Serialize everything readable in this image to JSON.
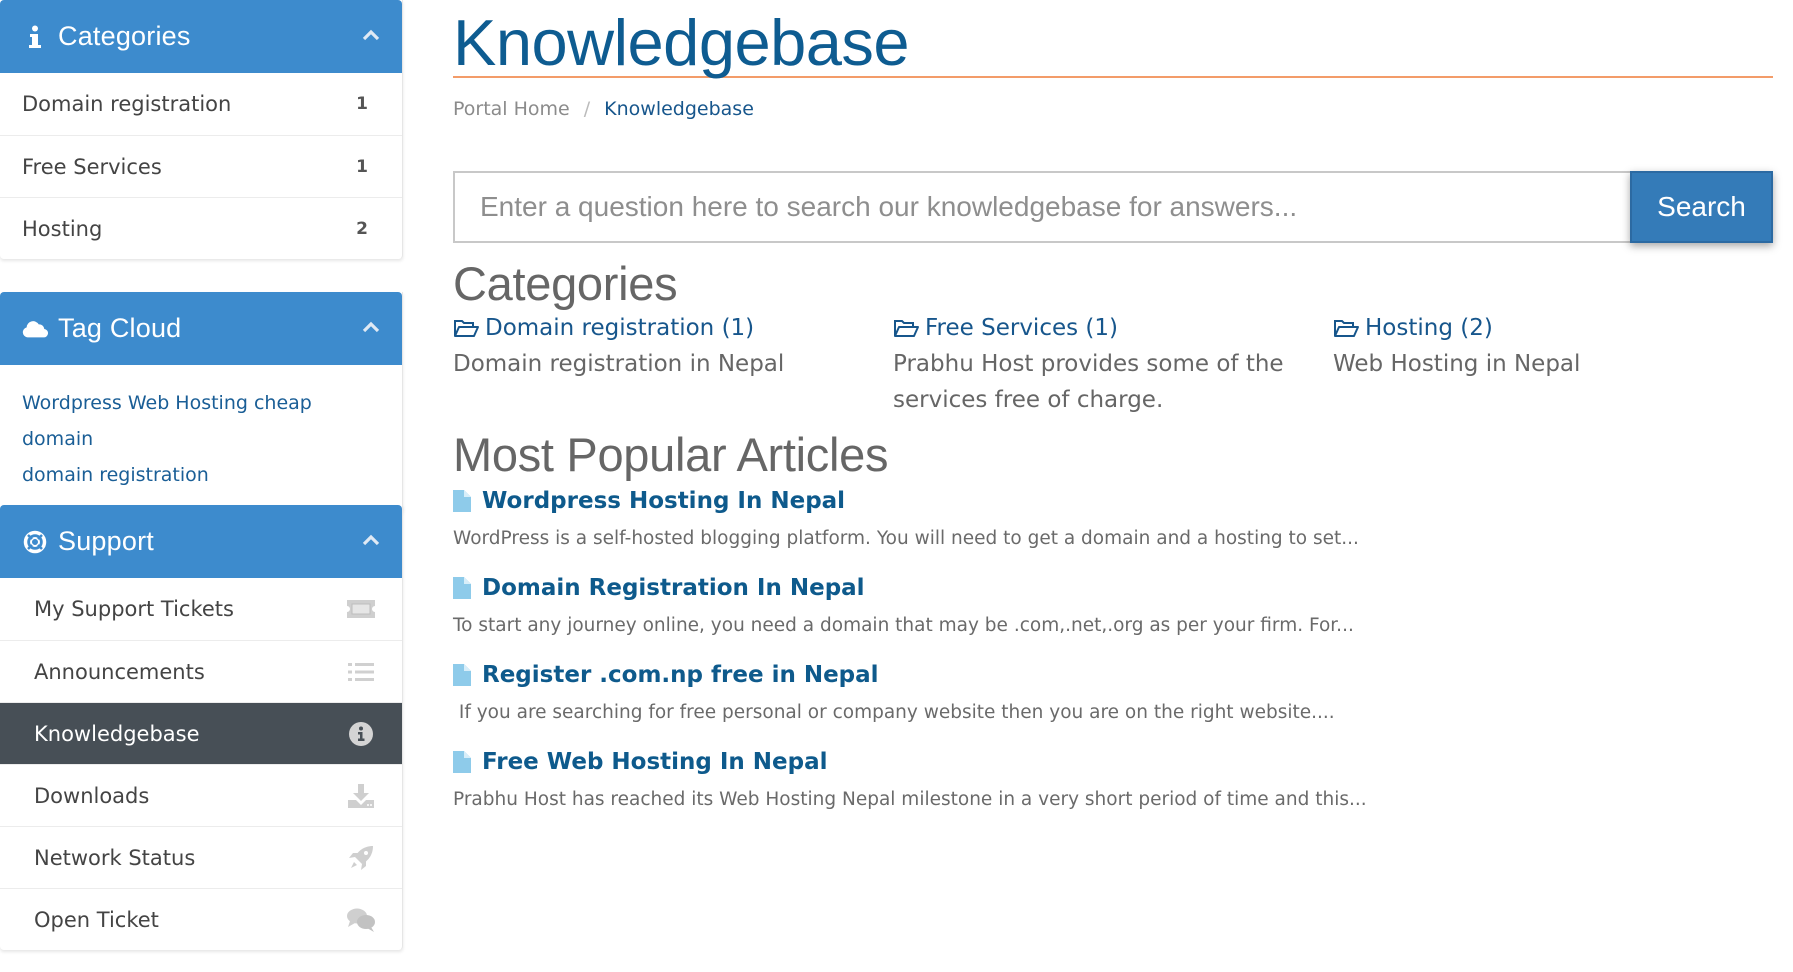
{
  "sidebar": {
    "categories": {
      "title": "Categories",
      "icon": "info-icon",
      "items": [
        {
          "label": "Domain registration",
          "count": "1"
        },
        {
          "label": "Free Services",
          "count": "1"
        },
        {
          "label": "Hosting",
          "count": "2"
        }
      ]
    },
    "tag_cloud": {
      "title": "Tag Cloud",
      "icon": "cloud-icon",
      "tags": [
        "Wordpress",
        "Web Hosting",
        "cheap domain",
        "domain registration"
      ]
    },
    "support": {
      "title": "Support",
      "icon": "lifebuoy-icon",
      "items": [
        {
          "label": "My Support Tickets",
          "icon": "ticket-icon",
          "active": false
        },
        {
          "label": "Announcements",
          "icon": "list-icon",
          "active": false
        },
        {
          "label": "Knowledgebase",
          "icon": "info-circle-icon",
          "active": true
        },
        {
          "label": "Downloads",
          "icon": "download-icon",
          "active": false
        },
        {
          "label": "Network Status",
          "icon": "rocket-icon",
          "active": false
        },
        {
          "label": "Open Ticket",
          "icon": "comments-icon",
          "active": false
        }
      ]
    }
  },
  "main": {
    "title": "Knowledgebase",
    "breadcrumb": [
      {
        "label": "Portal Home"
      },
      {
        "label": "Knowledgebase"
      }
    ],
    "breadcrumb_separator": "/",
    "search": {
      "placeholder": "Enter a question here to search our knowledgebase for answers...",
      "value": "",
      "button_label": "Search"
    },
    "categories_heading": "Categories",
    "categories": [
      {
        "label": "Domain registration (1)",
        "description": "Domain registration in Nepal"
      },
      {
        "label": "Free Services (1)",
        "description": "Prabhu Host provides some of the services free of charge."
      },
      {
        "label": "Hosting (2)",
        "description": "Web Hosting in Nepal"
      }
    ],
    "articles_heading": "Most Popular Articles",
    "articles": [
      {
        "title": "Wordpress Hosting In Nepal",
        "excerpt": "WordPress is a self-hosted blogging platform. You will need to get a domain and a hosting to set..."
      },
      {
        "title": "Domain Registration In Nepal",
        "excerpt": "To start any journey online, you need a domain that may be .com,.net,.org as per your firm. For..."
      },
      {
        "title": "Register .com.np free in Nepal",
        "excerpt": " If you are searching for free personal or company website then you are on the right website...."
      },
      {
        "title": "Free Web Hosting In Nepal",
        "excerpt": "Prabhu Host has reached its Web Hosting Nepal milestone in a very short period of time and this..."
      }
    ]
  },
  "colors": {
    "panel_header": "#3d8bcd",
    "active_item": "#474f56",
    "title_blue": "#0e5c91",
    "link_blue": "#17568c",
    "accent_rule": "#f39c69",
    "search_button": "#347bb8",
    "doc_icon": "#8ecbea"
  }
}
